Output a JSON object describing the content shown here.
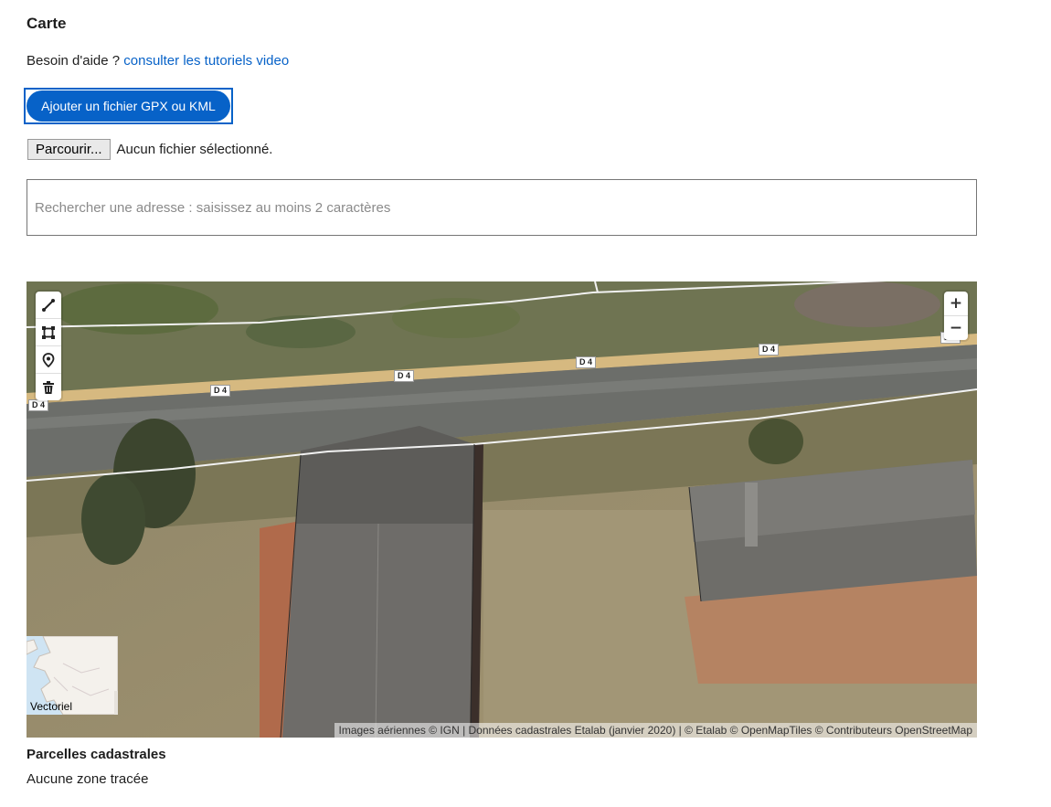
{
  "section": {
    "title": "Carte"
  },
  "help": {
    "prefix": "Besoin d'aide ? ",
    "link_text": "consulter les tutoriels video"
  },
  "upload": {
    "button_label": "Ajouter un fichier GPX ou KML",
    "browse_label": "Parcourir...",
    "status_text": "Aucun fichier sélectionné."
  },
  "search": {
    "placeholder": "Rechercher une adresse : saisissez au moins 2 caractères"
  },
  "map": {
    "road_labels": [
      "D 4",
      "D 4",
      "D 4",
      "D 4",
      "D 4",
      "D 4"
    ],
    "toolbar": [
      {
        "icon": "draw-line-icon"
      },
      {
        "icon": "draw-polygon-icon"
      },
      {
        "icon": "marker-icon"
      },
      {
        "icon": "trash-icon"
      }
    ],
    "zoom": {
      "in": "+",
      "out": "−"
    },
    "layer_switch_label": "Vectoriel",
    "attribution": "Images aériennes © IGN | Données cadastrales Etalab (janvier 2020) | © Etalab © OpenMapTiles © Contributeurs OpenStreetMap"
  },
  "parcels": {
    "title": "Parcelles cadastrales",
    "empty_text": "Aucune zone tracée"
  },
  "colors": {
    "primary": "#0762c8",
    "road_band": "#d6b980",
    "parcel_line": "#f2f2f2"
  }
}
